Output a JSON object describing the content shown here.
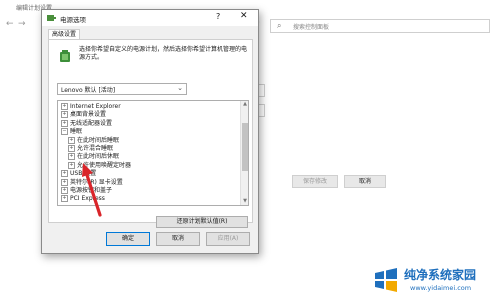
{
  "background_window": {
    "title": "编辑计划设置",
    "search_placeholder": "搜索控制面板",
    "save_button": "保存修改",
    "cancel_button": "取消"
  },
  "dialog": {
    "title": "电源选项",
    "help": "?",
    "close": "✕",
    "tab": "高级设置",
    "description": "选择你希望自定义的电源计划，然后选择你希望计算机管理的电源方式。",
    "plan_select": "Lenovo 默认 [活动]",
    "tree": [
      {
        "sign": "+",
        "label": "Internet Explorer",
        "level": 0
      },
      {
        "sign": "+",
        "label": "桌面背景设置",
        "level": 0
      },
      {
        "sign": "+",
        "label": "无线适配器设置",
        "level": 0
      },
      {
        "sign": "−",
        "label": "睡眠",
        "level": 0
      },
      {
        "sign": "+",
        "label": "在此时间后睡眠",
        "level": 1
      },
      {
        "sign": "+",
        "label": "允许混合睡眠",
        "level": 1
      },
      {
        "sign": "+",
        "label": "在此时间后休眠",
        "level": 1
      },
      {
        "sign": "+",
        "label": "允许使用唤醒定时器",
        "level": 1
      },
      {
        "sign": "+",
        "label": "USB 设置",
        "level": 0
      },
      {
        "sign": "+",
        "label": "英特尔(R) 显卡设置",
        "level": 0
      },
      {
        "sign": "+",
        "label": "电源按钮和盖子",
        "level": 0
      },
      {
        "sign": "+",
        "label": "PCI Express",
        "level": 0
      }
    ],
    "restore_button": "还原计划默认值(R)",
    "ok_button": "确定",
    "cancel_button": "取消",
    "apply_button": "应用(A)"
  },
  "watermark": {
    "title": "纯净系统家园",
    "url": "www.yidaimei.com"
  },
  "colors": {
    "accent": "#0078d7",
    "watermark": "#1e6fbd"
  }
}
